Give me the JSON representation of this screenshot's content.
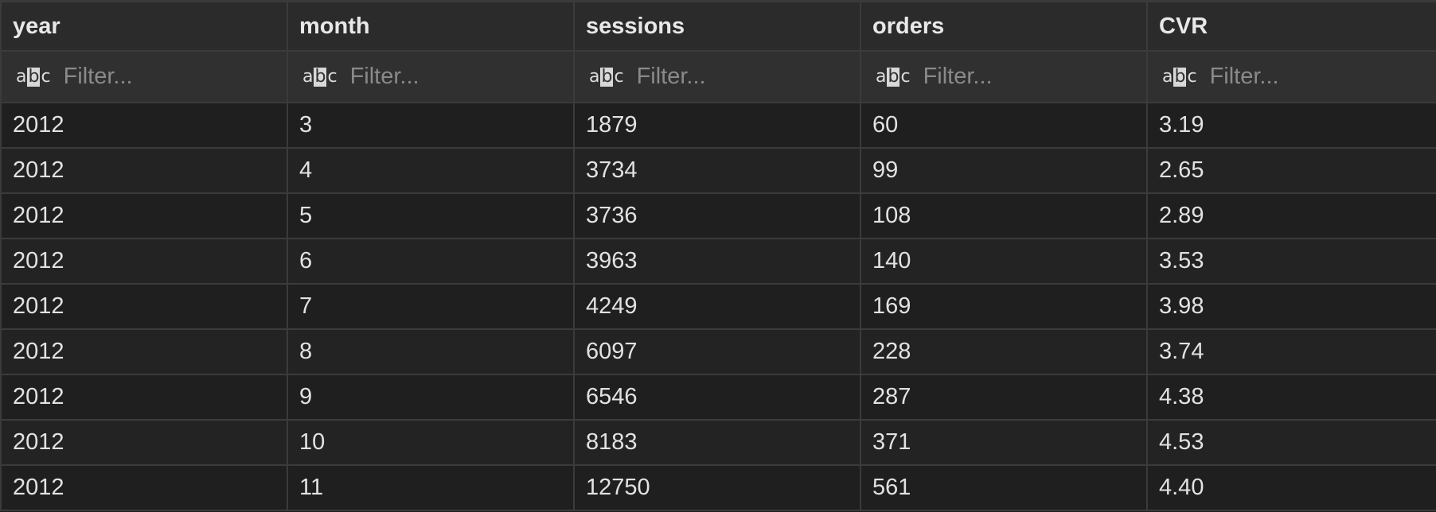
{
  "columns": [
    "year",
    "month",
    "sessions",
    "orders",
    "CVR"
  ],
  "filter": {
    "icon": "abc-text-type-icon",
    "placeholder": "Filter..."
  },
  "rows": [
    [
      "2012",
      "3",
      "1879",
      "60",
      "3.19"
    ],
    [
      "2012",
      "4",
      "3734",
      "99",
      "2.65"
    ],
    [
      "2012",
      "5",
      "3736",
      "108",
      "2.89"
    ],
    [
      "2012",
      "6",
      "3963",
      "140",
      "3.53"
    ],
    [
      "2012",
      "7",
      "4249",
      "169",
      "3.98"
    ],
    [
      "2012",
      "8",
      "6097",
      "228",
      "3.74"
    ],
    [
      "2012",
      "9",
      "6546",
      "287",
      "4.38"
    ],
    [
      "2012",
      "10",
      "8183",
      "371",
      "4.53"
    ],
    [
      "2012",
      "11",
      "12750",
      "561",
      "4.40"
    ]
  ]
}
